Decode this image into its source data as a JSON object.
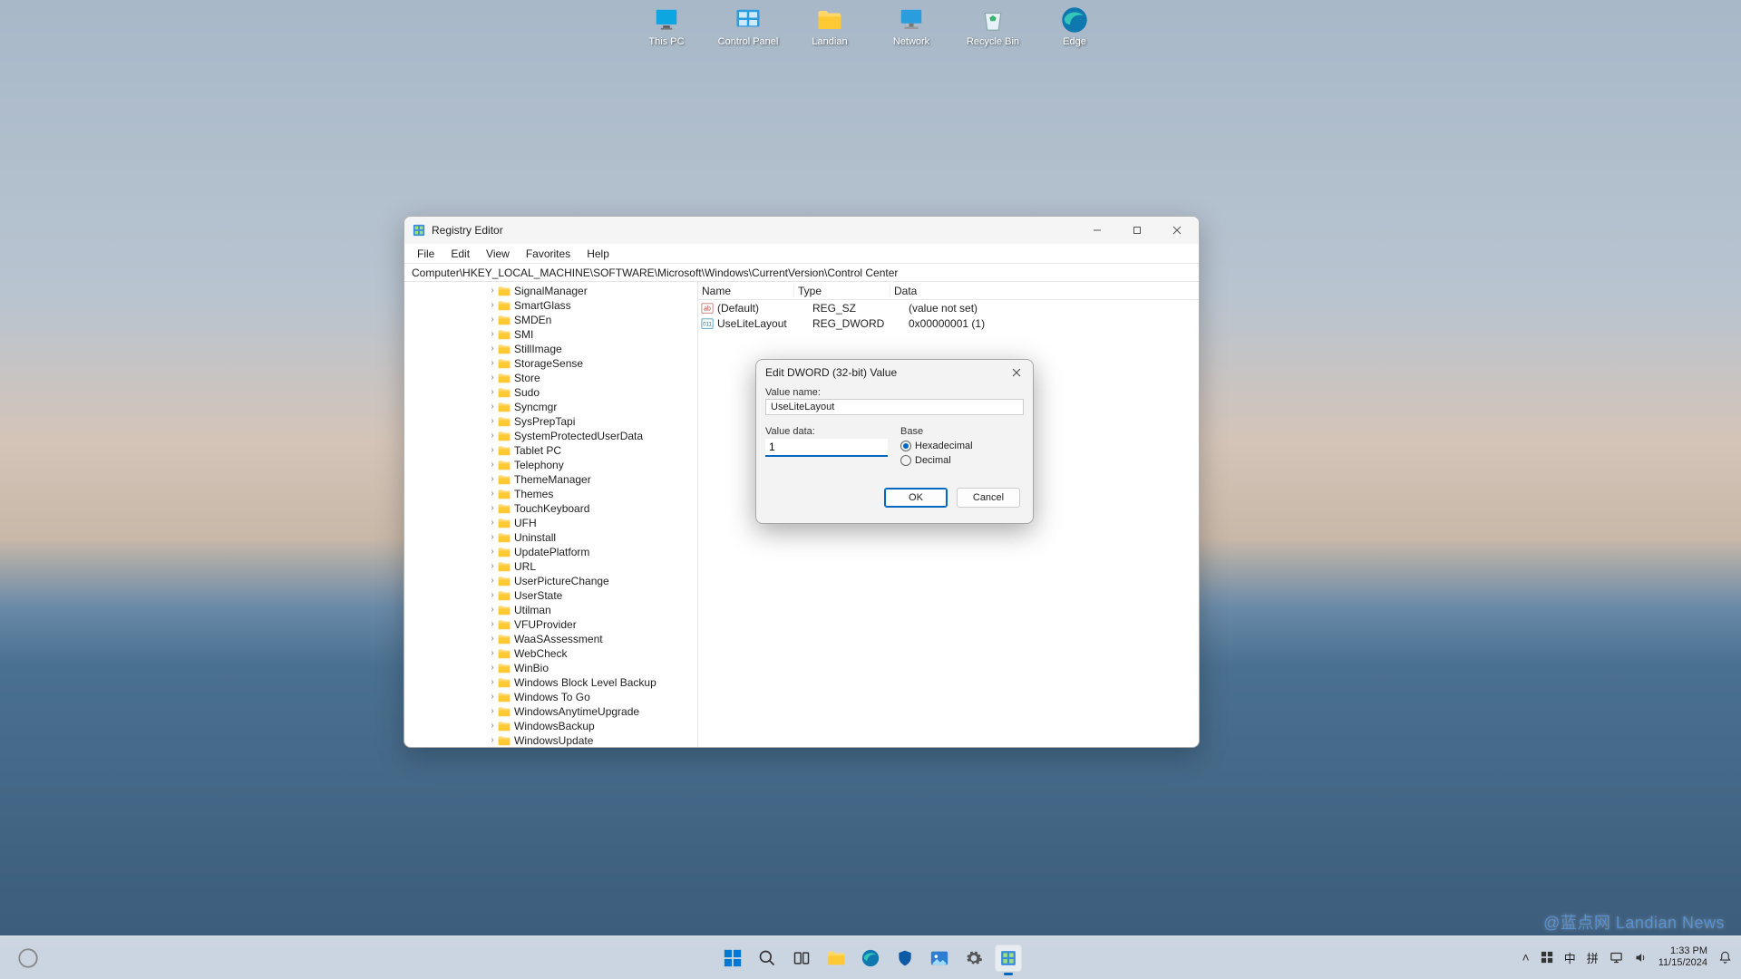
{
  "desktop": {
    "icons": [
      {
        "label": "This PC",
        "name": "desktop-icon-this-pc",
        "glyph": "monitor"
      },
      {
        "label": "Control Panel",
        "name": "desktop-icon-control-panel",
        "glyph": "control"
      },
      {
        "label": "Landian",
        "name": "desktop-icon-landian",
        "glyph": "folder"
      },
      {
        "label": "Network",
        "name": "desktop-icon-network",
        "glyph": "network"
      },
      {
        "label": "Recycle Bin",
        "name": "desktop-icon-recycle-bin",
        "glyph": "recycle"
      },
      {
        "label": "Edge",
        "name": "desktop-icon-edge",
        "glyph": "edge"
      }
    ]
  },
  "window": {
    "title": "Registry Editor",
    "menu": [
      "File",
      "Edit",
      "View",
      "Favorites",
      "Help"
    ],
    "address": "Computer\\HKEY_LOCAL_MACHINE\\SOFTWARE\\Microsoft\\Windows\\CurrentVersion\\Control Center",
    "tree": [
      "SignalManager",
      "SmartGlass",
      "SMDEn",
      "SMI",
      "StillImage",
      "StorageSense",
      "Store",
      "Sudo",
      "Syncmgr",
      "SysPrepTapi",
      "SystemProtectedUserData",
      "Tablet PC",
      "Telephony",
      "ThemeManager",
      "Themes",
      "TouchKeyboard",
      "UFH",
      "Uninstall",
      "UpdatePlatform",
      "URL",
      "UserPictureChange",
      "UserState",
      "Utilman",
      "VFUProvider",
      "WaaSAssessment",
      "WebCheck",
      "WinBio",
      "Windows Block Level Backup",
      "Windows To Go",
      "WindowsAnytimeUpgrade",
      "WindowsBackup",
      "WindowsUpdate"
    ],
    "columns": {
      "name": "Name",
      "type": "Type",
      "data": "Data"
    },
    "rows": [
      {
        "icon": "sz",
        "name": "(Default)",
        "type": "REG_SZ",
        "data": "(value not set)"
      },
      {
        "icon": "dw",
        "name": "UseLiteLayout",
        "type": "REG_DWORD",
        "data": "0x00000001 (1)"
      }
    ]
  },
  "dialog": {
    "title": "Edit DWORD (32-bit) Value",
    "labels": {
      "value_name": "Value name:",
      "value_data": "Value data:",
      "base": "Base",
      "hex": "Hexadecimal",
      "dec": "Decimal"
    },
    "value_name": "UseLiteLayout",
    "value_data": "1",
    "base_selected": "hex",
    "buttons": {
      "ok": "OK",
      "cancel": "Cancel"
    }
  },
  "taskbar": {
    "tray": {
      "ime1": "中",
      "ime2": "拼"
    },
    "clock": {
      "time": "1:33 PM",
      "date": "11/15/2024"
    }
  },
  "watermark": "@蓝点网 Landian News"
}
